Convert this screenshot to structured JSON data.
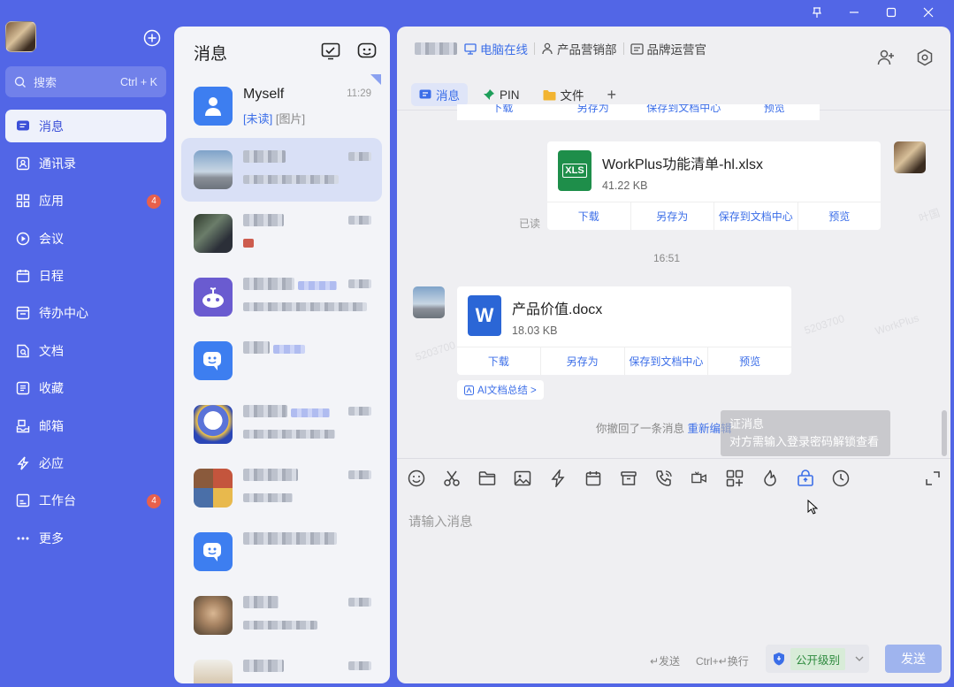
{
  "window": {
    "controls": [
      "pin-icon",
      "minimize-icon",
      "maximize-icon",
      "close-icon"
    ]
  },
  "nav": {
    "search_placeholder": "搜索",
    "search_shortcut": "Ctrl + K",
    "items": [
      {
        "label": "消息",
        "icon": "message-icon",
        "active": true,
        "badge": ""
      },
      {
        "label": "通讯录",
        "icon": "contacts-icon",
        "badge": ""
      },
      {
        "label": "应用",
        "icon": "apps-icon",
        "badge": "4"
      },
      {
        "label": "会议",
        "icon": "meeting-icon",
        "badge": ""
      },
      {
        "label": "日程",
        "icon": "calendar-icon",
        "badge": ""
      },
      {
        "label": "待办中心",
        "icon": "todo-icon",
        "badge": ""
      },
      {
        "label": "文档",
        "icon": "document-icon",
        "badge": ""
      },
      {
        "label": "收藏",
        "icon": "favorites-icon",
        "badge": ""
      },
      {
        "label": "邮箱",
        "icon": "mail-icon",
        "badge": ""
      },
      {
        "label": "必应",
        "icon": "lightning-icon",
        "badge": ""
      },
      {
        "label": "工作台",
        "icon": "workbench-icon",
        "badge": "4"
      },
      {
        "label": "更多",
        "icon": "more-icon",
        "badge": ""
      }
    ]
  },
  "conversations": {
    "title": "消息",
    "items": [
      {
        "name": "Myself",
        "time": "11:29",
        "preview_unread": "[未读]",
        "preview": " [图片]"
      }
    ]
  },
  "chat": {
    "header": {
      "status": "电脑在线",
      "department": "产品营销部",
      "role": "品牌运营官"
    },
    "tabs": [
      {
        "label": "消息",
        "icon": "message-icon"
      },
      {
        "label": "PIN",
        "icon": "pin-icon"
      },
      {
        "label": "文件",
        "icon": "folder-icon"
      }
    ],
    "top_actions": [
      "下载",
      "另存为",
      "保存到文档中心",
      "预览"
    ],
    "files": [
      {
        "name": "WorkPlus功能清单-hl.xlsx",
        "size": "41.22 KB",
        "type": "XLS",
        "color": "#1e8e4a"
      },
      {
        "name": "产品价值.docx",
        "size": "18.03 KB",
        "type": "W",
        "color": "#2b66d6"
      }
    ],
    "file_actions": [
      "下载",
      "另存为",
      "保存到文档中心",
      "预览"
    ],
    "read_status": "已读",
    "time_divider": "16:51",
    "ai_summary": "AI文档总结 >",
    "recall_notice": "你撤回了一条消息",
    "recall_reedit": "重新编辑",
    "tooltip_line1": "证消息",
    "tooltip_line2": "对方需输入登录密码解锁查看",
    "composer": {
      "placeholder": "请输入消息",
      "hint_send": "↵发送",
      "hint_newline": "Ctrl+↵换行",
      "security_level": "公开级别",
      "send_label": "发送"
    },
    "toolbar_icons": [
      "emoji-icon",
      "scissors-icon",
      "folder-icon",
      "image-icon",
      "lightning-icon",
      "calendar-icon",
      "archive-icon",
      "phone-icon",
      "video-icon",
      "screen-share-icon",
      "burn-icon",
      "lock-icon",
      "clock-icon"
    ]
  }
}
